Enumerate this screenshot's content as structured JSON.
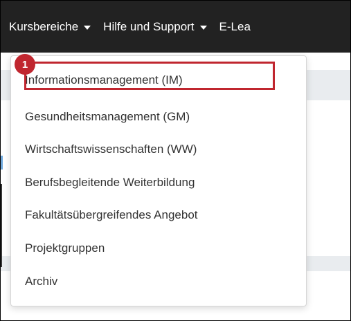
{
  "navbar": {
    "items": [
      {
        "label": "Kursbereiche",
        "has_caret": true
      },
      {
        "label": "Hilfe und Support",
        "has_caret": true
      },
      {
        "label": "E-Lea",
        "has_caret": false
      }
    ]
  },
  "dropdown": {
    "items": [
      {
        "label": "Informationsmanagement (IM)"
      },
      {
        "label": "Gesundheitsmanagement (GM)"
      },
      {
        "label": "Wirtschaftswissenschaften (WW)"
      },
      {
        "label": "Berufsbegleitende Weiterbildung"
      },
      {
        "label": "Fakultätsübergreifendes Angebot"
      },
      {
        "label": "Projektgruppen"
      },
      {
        "label": "Archiv"
      }
    ]
  },
  "annotation": {
    "step_number": "1",
    "highlight_color": "#c0262f"
  },
  "colors": {
    "navbar_bg": "#222222",
    "navbar_text": "#ffffff",
    "menu_text": "#333333"
  }
}
